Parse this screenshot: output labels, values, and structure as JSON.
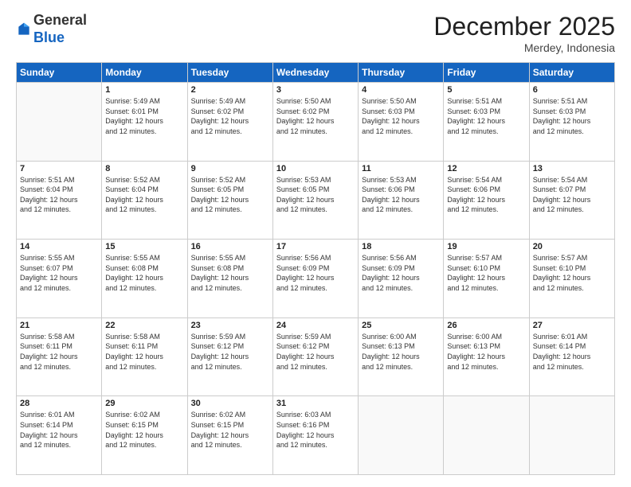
{
  "logo": {
    "general": "General",
    "blue": "Blue"
  },
  "header": {
    "month_year": "December 2025",
    "location": "Merdey, Indonesia"
  },
  "days_of_week": [
    "Sunday",
    "Monday",
    "Tuesday",
    "Wednesday",
    "Thursday",
    "Friday",
    "Saturday"
  ],
  "weeks": [
    [
      {
        "day": "",
        "info": ""
      },
      {
        "day": "1",
        "info": "Sunrise: 5:49 AM\nSunset: 6:01 PM\nDaylight: 12 hours\nand 12 minutes."
      },
      {
        "day": "2",
        "info": "Sunrise: 5:49 AM\nSunset: 6:02 PM\nDaylight: 12 hours\nand 12 minutes."
      },
      {
        "day": "3",
        "info": "Sunrise: 5:50 AM\nSunset: 6:02 PM\nDaylight: 12 hours\nand 12 minutes."
      },
      {
        "day": "4",
        "info": "Sunrise: 5:50 AM\nSunset: 6:03 PM\nDaylight: 12 hours\nand 12 minutes."
      },
      {
        "day": "5",
        "info": "Sunrise: 5:51 AM\nSunset: 6:03 PM\nDaylight: 12 hours\nand 12 minutes."
      },
      {
        "day": "6",
        "info": "Sunrise: 5:51 AM\nSunset: 6:03 PM\nDaylight: 12 hours\nand 12 minutes."
      }
    ],
    [
      {
        "day": "7",
        "info": "Sunrise: 5:51 AM\nSunset: 6:04 PM\nDaylight: 12 hours\nand 12 minutes."
      },
      {
        "day": "8",
        "info": "Sunrise: 5:52 AM\nSunset: 6:04 PM\nDaylight: 12 hours\nand 12 minutes."
      },
      {
        "day": "9",
        "info": "Sunrise: 5:52 AM\nSunset: 6:05 PM\nDaylight: 12 hours\nand 12 minutes."
      },
      {
        "day": "10",
        "info": "Sunrise: 5:53 AM\nSunset: 6:05 PM\nDaylight: 12 hours\nand 12 minutes."
      },
      {
        "day": "11",
        "info": "Sunrise: 5:53 AM\nSunset: 6:06 PM\nDaylight: 12 hours\nand 12 minutes."
      },
      {
        "day": "12",
        "info": "Sunrise: 5:54 AM\nSunset: 6:06 PM\nDaylight: 12 hours\nand 12 minutes."
      },
      {
        "day": "13",
        "info": "Sunrise: 5:54 AM\nSunset: 6:07 PM\nDaylight: 12 hours\nand 12 minutes."
      }
    ],
    [
      {
        "day": "14",
        "info": "Sunrise: 5:55 AM\nSunset: 6:07 PM\nDaylight: 12 hours\nand 12 minutes."
      },
      {
        "day": "15",
        "info": "Sunrise: 5:55 AM\nSunset: 6:08 PM\nDaylight: 12 hours\nand 12 minutes."
      },
      {
        "day": "16",
        "info": "Sunrise: 5:55 AM\nSunset: 6:08 PM\nDaylight: 12 hours\nand 12 minutes."
      },
      {
        "day": "17",
        "info": "Sunrise: 5:56 AM\nSunset: 6:09 PM\nDaylight: 12 hours\nand 12 minutes."
      },
      {
        "day": "18",
        "info": "Sunrise: 5:56 AM\nSunset: 6:09 PM\nDaylight: 12 hours\nand 12 minutes."
      },
      {
        "day": "19",
        "info": "Sunrise: 5:57 AM\nSunset: 6:10 PM\nDaylight: 12 hours\nand 12 minutes."
      },
      {
        "day": "20",
        "info": "Sunrise: 5:57 AM\nSunset: 6:10 PM\nDaylight: 12 hours\nand 12 minutes."
      }
    ],
    [
      {
        "day": "21",
        "info": "Sunrise: 5:58 AM\nSunset: 6:11 PM\nDaylight: 12 hours\nand 12 minutes."
      },
      {
        "day": "22",
        "info": "Sunrise: 5:58 AM\nSunset: 6:11 PM\nDaylight: 12 hours\nand 12 minutes."
      },
      {
        "day": "23",
        "info": "Sunrise: 5:59 AM\nSunset: 6:12 PM\nDaylight: 12 hours\nand 12 minutes."
      },
      {
        "day": "24",
        "info": "Sunrise: 5:59 AM\nSunset: 6:12 PM\nDaylight: 12 hours\nand 12 minutes."
      },
      {
        "day": "25",
        "info": "Sunrise: 6:00 AM\nSunset: 6:13 PM\nDaylight: 12 hours\nand 12 minutes."
      },
      {
        "day": "26",
        "info": "Sunrise: 6:00 AM\nSunset: 6:13 PM\nDaylight: 12 hours\nand 12 minutes."
      },
      {
        "day": "27",
        "info": "Sunrise: 6:01 AM\nSunset: 6:14 PM\nDaylight: 12 hours\nand 12 minutes."
      }
    ],
    [
      {
        "day": "28",
        "info": "Sunrise: 6:01 AM\nSunset: 6:14 PM\nDaylight: 12 hours\nand 12 minutes."
      },
      {
        "day": "29",
        "info": "Sunrise: 6:02 AM\nSunset: 6:15 PM\nDaylight: 12 hours\nand 12 minutes."
      },
      {
        "day": "30",
        "info": "Sunrise: 6:02 AM\nSunset: 6:15 PM\nDaylight: 12 hours\nand 12 minutes."
      },
      {
        "day": "31",
        "info": "Sunrise: 6:03 AM\nSunset: 6:16 PM\nDaylight: 12 hours\nand 12 minutes."
      },
      {
        "day": "",
        "info": ""
      },
      {
        "day": "",
        "info": ""
      },
      {
        "day": "",
        "info": ""
      }
    ]
  ]
}
